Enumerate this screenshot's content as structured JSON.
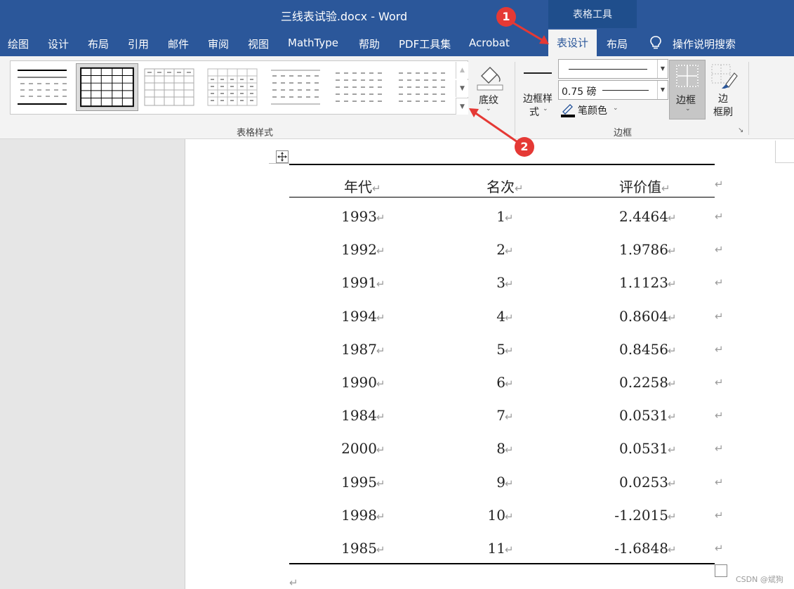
{
  "window": {
    "title": "三线表试验.docx  -  Word",
    "context_group": "表格工具"
  },
  "tabs": [
    "绘图",
    "设计",
    "布局",
    "引用",
    "邮件",
    "审阅",
    "视图",
    "MathType",
    "帮助",
    "PDF工具集",
    "Acrobat"
  ],
  "active_tab": "表设计",
  "context_tab_2": "布局",
  "tell_me": "操作说明搜索",
  "ribbon": {
    "table_styles_label": "表格样式",
    "shading_label": "底纹",
    "border_styles_label": "边框样\n式",
    "border_styles_line1": "边框样",
    "border_styles_line2": "式",
    "pen_weight": "0.75 磅",
    "pen_color_label": "笔颜色",
    "borders_label": "边框",
    "border_painter_line1": "边",
    "border_painter_line2": "框刷",
    "borders_group_label": "边框"
  },
  "table": {
    "headers": [
      "年代",
      "名次",
      "评价值"
    ],
    "rows": [
      [
        "1993",
        "1",
        "2.4464"
      ],
      [
        "1992",
        "2",
        "1.9786"
      ],
      [
        "1991",
        "3",
        "1.1123"
      ],
      [
        "1994",
        "4",
        "0.8604"
      ],
      [
        "1987",
        "5",
        "0.8456"
      ],
      [
        "1990",
        "6",
        "0.2258"
      ],
      [
        "1984",
        "7",
        "0.0531"
      ],
      [
        "2000",
        "8",
        "0.0531"
      ],
      [
        "1995",
        "9",
        "0.0253"
      ],
      [
        "1998",
        "10",
        "-1.2015"
      ],
      [
        "1985",
        "11",
        "-1.6848"
      ]
    ]
  },
  "annotations": [
    "1",
    "2"
  ],
  "watermark": "CSDN @斌狗",
  "colors": {
    "title_bar": "#2b579a",
    "ribbon": "#f3f3f3",
    "badge": "#e53935"
  }
}
